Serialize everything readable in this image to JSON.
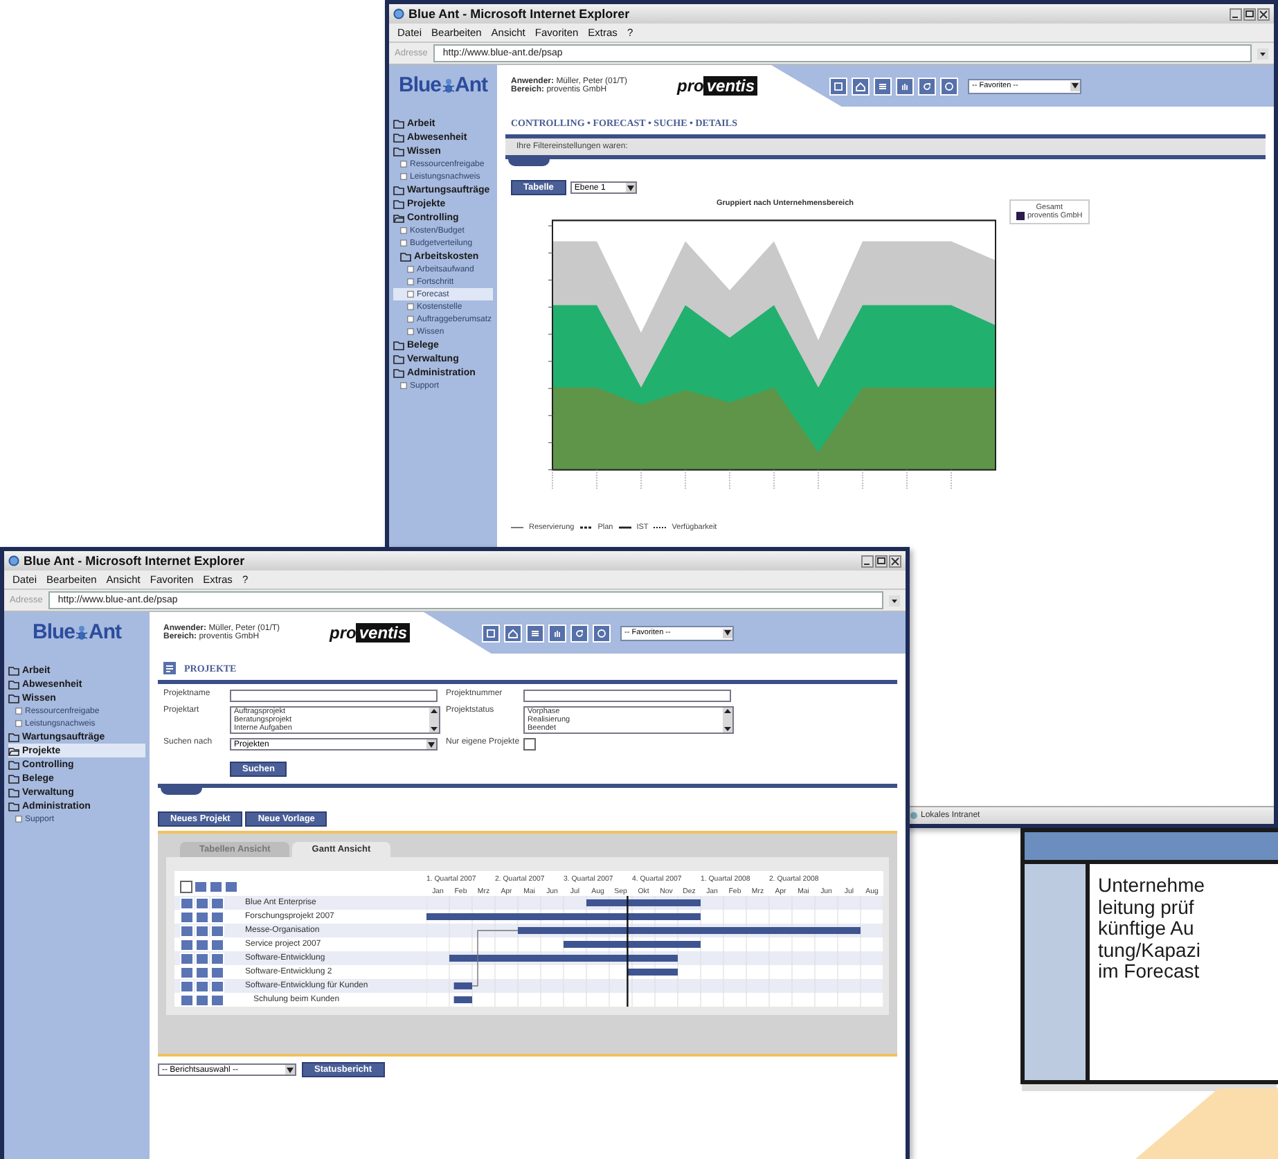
{
  "forecast_window": {
    "title": "Blue Ant - Microsoft Internet Explorer",
    "menu": [
      "Datei",
      "Bearbeiten",
      "Ansicht",
      "Favoriten",
      "Extras",
      "?"
    ],
    "address_label": "Adresse",
    "url": "http://www.blue-ant.de/psap",
    "logo": [
      "Blue",
      "Ant"
    ],
    "header": {
      "user_label": "Anwender:",
      "user": "Müller, Peter (01/T)",
      "area_label": "Bereich:",
      "area": "proventis GmbH",
      "brand": [
        "pro",
        "ventis"
      ],
      "favorites": "-- Favoriten --"
    },
    "sidebar": [
      {
        "label": "Arbeit",
        "kind": "folder",
        "expanded": false,
        "selected": false
      },
      {
        "label": "Abwesenheit",
        "kind": "folder",
        "expanded": false,
        "selected": false
      },
      {
        "label": "Wissen",
        "kind": "folder",
        "expanded": false,
        "selected": false,
        "children": [
          {
            "label": "Ressourcenfreigabe",
            "kind": "page",
            "selected": false
          },
          {
            "label": "Leistungsnachweis",
            "kind": "page",
            "selected": false
          }
        ]
      },
      {
        "label": "Wartungsaufträge",
        "kind": "folder",
        "expanded": false,
        "selected": false
      },
      {
        "label": "Projekte",
        "kind": "folder",
        "expanded": false,
        "selected": false
      },
      {
        "label": "Controlling",
        "kind": "folder",
        "expanded": true,
        "selected": false,
        "children": [
          {
            "label": "Kosten/Budget",
            "kind": "page",
            "selected": false
          },
          {
            "label": "Budgetverteilung",
            "kind": "page",
            "selected": false
          },
          {
            "label": "Arbeitskosten",
            "kind": "folder",
            "expanded": false,
            "selected": false,
            "children": [
              {
                "label": "Arbeitsaufwand",
                "kind": "page",
                "selected": false
              },
              {
                "label": "Fortschritt",
                "kind": "page",
                "selected": false
              },
              {
                "label": "Forecast",
                "kind": "page",
                "selected": true
              },
              {
                "label": "Kostenstelle",
                "kind": "page",
                "selected": false
              },
              {
                "label": "Auftraggeberumsatz",
                "kind": "page",
                "selected": false
              },
              {
                "label": "Wissen",
                "kind": "page",
                "selected": false
              }
            ]
          }
        ]
      },
      {
        "label": "Belege",
        "kind": "folder",
        "expanded": false,
        "selected": false
      },
      {
        "label": "Verwaltung",
        "kind": "folder",
        "expanded": false,
        "selected": false
      },
      {
        "label": "Administration",
        "kind": "folder",
        "expanded": false,
        "selected": false,
        "children": [
          {
            "label": "Support",
            "kind": "page",
            "selected": false
          }
        ]
      }
    ],
    "breadcrumb": "CONTROLLING • FORECAST • SUCHE • DETAILS",
    "filter_note": "Ihre Filtereinstellungen waren:",
    "view_button": "Tabelle",
    "level_select": "Ebene 1",
    "chart_title": "Gruppiert nach Unternehmensbereich",
    "legend_title": "Gesamt",
    "legend_item": "proventis GmbH",
    "bottom_legend": [
      "Reservierung",
      "Plan",
      "IST",
      "Verfügbarkeit"
    ],
    "status": "Lokales Intranet"
  },
  "projects_window": {
    "title": "Blue Ant - Microsoft Internet Explorer",
    "menu": [
      "Datei",
      "Bearbeiten",
      "Ansicht",
      "Favoriten",
      "Extras",
      "?"
    ],
    "address_label": "Adresse",
    "url": "http://www.blue-ant.de/psap",
    "logo": [
      "Blue",
      "Ant"
    ],
    "header": {
      "user_label": "Anwender:",
      "user": "Müller, Peter (01/T)",
      "area_label": "Bereich:",
      "area": "proventis GmbH",
      "brand": [
        "pro",
        "ventis"
      ],
      "favorites": "-- Favoriten --"
    },
    "sidebar": [
      {
        "label": "Arbeit",
        "kind": "folder",
        "expanded": false,
        "selected": false
      },
      {
        "label": "Abwesenheit",
        "kind": "folder",
        "expanded": false,
        "selected": false
      },
      {
        "label": "Wissen",
        "kind": "folder",
        "expanded": false,
        "selected": false,
        "children": [
          {
            "label": "Ressourcenfreigabe",
            "kind": "page",
            "selected": false
          },
          {
            "label": "Leistungsnachweis",
            "kind": "page",
            "selected": false
          }
        ]
      },
      {
        "label": "Wartungsaufträge",
        "kind": "folder",
        "expanded": false,
        "selected": false
      },
      {
        "label": "Projekte",
        "kind": "folder",
        "expanded": true,
        "selected": true
      },
      {
        "label": "Controlling",
        "kind": "folder",
        "expanded": false,
        "selected": false
      },
      {
        "label": "Belege",
        "kind": "folder",
        "expanded": false,
        "selected": false
      },
      {
        "label": "Verwaltung",
        "kind": "folder",
        "expanded": false,
        "selected": false
      },
      {
        "label": "Administration",
        "kind": "folder",
        "expanded": false,
        "selected": false,
        "children": [
          {
            "label": "Support",
            "kind": "page",
            "selected": false
          }
        ]
      }
    ],
    "section_title": "PROJEKTE",
    "fields": [
      {
        "kind": "text",
        "label": "Projektname"
      },
      {
        "kind": "text",
        "label": "Projektnummer"
      },
      {
        "kind": "listbox",
        "label": "Projektart",
        "options": [
          "Auftragsprojekt",
          "Beratungsprojekt",
          "Interne Aufgaben"
        ]
      },
      {
        "kind": "listbox",
        "label": "Projektstatus",
        "options": [
          "Vorphase",
          "Realisierung",
          "Beendet"
        ]
      },
      {
        "kind": "select",
        "label": "Suchen nach",
        "value": "Projekten"
      },
      {
        "kind": "checkbox",
        "label": "Nur eigene Projekte",
        "checked": false
      }
    ],
    "search_button": "Suchen",
    "actions": [
      "Neues Projekt",
      "Neue Vorlage"
    ],
    "tabs": [
      {
        "label": "Tabellen Ansicht",
        "selected": false
      },
      {
        "label": "Gantt Ansicht",
        "selected": true
      }
    ],
    "gantt": {
      "select_all": {
        "checked": false
      },
      "quarters": [
        "1. Quartal 2007",
        "2. Quartal 2007",
        "3. Quartal 2007",
        "4. Quartal 2007",
        "1. Quartal 2008",
        "2. Quartal 2008"
      ],
      "months": [
        "Jan",
        "Feb",
        "Mrz",
        "Apr",
        "Mai",
        "Jun",
        "Jul",
        "Aug",
        "Sep",
        "Okt",
        "Nov",
        "Dez",
        "Jan",
        "Feb",
        "Mrz",
        "Apr",
        "Mai",
        "Jun",
        "Jul",
        "Aug"
      ],
      "rows": [
        {
          "name": "Blue Ant Enterprise"
        },
        {
          "name": "Forschungsprojekt 2007"
        },
        {
          "name": "Messe-Organisation"
        },
        {
          "name": "Service project 2007"
        },
        {
          "name": "Software-Entwicklung"
        },
        {
          "name": "Software-Entwicklung 2"
        },
        {
          "name": "Software-Entwicklung für Kunden",
          "children": [
            {
              "name": "Schulung beim Kunden"
            }
          ]
        }
      ]
    },
    "report_select": "-- Berichtsauswahl --",
    "report_button": "Statusbericht"
  },
  "callout": {
    "lines": [
      "Unternehme",
      "leitung prüf",
      "künftige Au",
      "tung/Kapazi",
      "im Forecast"
    ]
  }
}
